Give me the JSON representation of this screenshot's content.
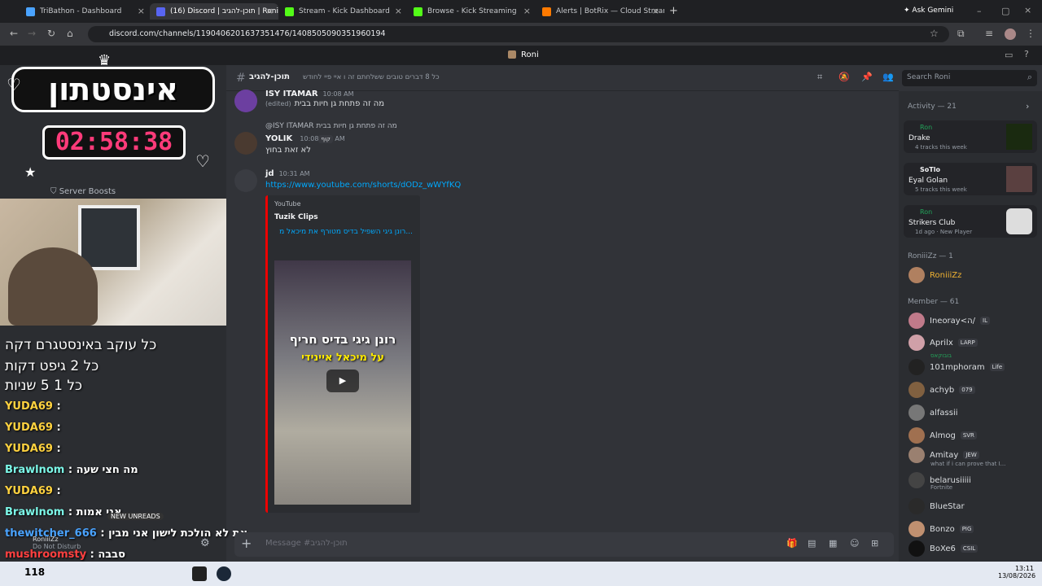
{
  "tabs": [
    {
      "label": "TriBathon - Dashboard",
      "color": "#4aa3ff"
    },
    {
      "label": "(16) Discord | תוכן-להגיב | Roni",
      "color": "#5865f2"
    },
    {
      "label": "Stream - Kick Dashboard",
      "color": "#53fc18"
    },
    {
      "label": "Browse - Kick Streaming",
      "color": "#53fc18"
    },
    {
      "label": "Alerts | BotRix — Cloud Stream",
      "color": "#ff7a00"
    }
  ],
  "gemini_label": "Ask Gemini",
  "url": "discord.com/channels/1190406201637351476/1408505090351960194",
  "server_name": "Roni",
  "overlay": {
    "logo_text": "אינסטתון",
    "timer": "02:58:38",
    "server_boosts": "Server Boosts"
  },
  "channel": {
    "name": "תוכן-להגיב",
    "topic": "כל 8 דברים טובים ששלחתם זה ו איי פיי לחודש",
    "search_placeholder": "Search Roni"
  },
  "messages": [
    {
      "user": "ISY ITAMAR",
      "time": "10:08 AM",
      "text": "מה זה פתחת גן חיות בבית",
      "edited": "(edited)"
    },
    {
      "reply": "@ISY ITAMAR",
      "reply_text": "מה זה פתחת גן חיות בבית",
      "user": "YOLIK",
      "tag": "קוף",
      "time": "10:08 AM",
      "text": "לא זאת בחוץ"
    },
    {
      "user": "jd",
      "time": "10:31 AM",
      "text": "https://www.youtube.com/shorts/dODz_wWYfKQ"
    }
  ],
  "embed": {
    "provider": "YouTube",
    "author": "Tuzik Clips",
    "title": "רונן גיגי השפיל בדיס מטורף את מיכאל מ...",
    "caption1": "רונן גיגי בדיס חריף",
    "caption2": "על מיכאל איינידי"
  },
  "composer_placeholder": "Message #תוכן-להגיב",
  "members": {
    "activity_header": "Activity — 21",
    "activities": [
      {
        "user": "Ron",
        "title": "Drake",
        "sub": "4 tracks this week"
      },
      {
        "user": "SoTlo",
        "title": "Eyal Golan",
        "sub": "5 tracks this week"
      },
      {
        "user": "Ron",
        "title": "Strikers Club",
        "sub": "1d ago",
        "sub2": "New Player"
      }
    ],
    "role_header": "RoniiiZz — 1",
    "role_member": "RoniiiZz",
    "member_header": "Member — 61",
    "list": [
      {
        "name": "Ineoray<ה/",
        "tag": "IL"
      },
      {
        "name": "Aprilx",
        "tag": "LARP",
        "sub": "בובוקאס"
      },
      {
        "name": "101mphoram",
        "tag": "Life"
      },
      {
        "name": "achyb",
        "tag": "079"
      },
      {
        "name": "alfassii",
        "tag": ""
      },
      {
        "name": "Almog",
        "tag": "SVR"
      },
      {
        "name": "Amitay",
        "tag": "JEW",
        "sub": "what if i can prove that I..."
      },
      {
        "name": "belarusiiiii",
        "tag": "",
        "sub": "Fortnite"
      },
      {
        "name": "BlueStar",
        "tag": ""
      },
      {
        "name": "Bonzo",
        "tag": "PIG"
      },
      {
        "name": "BoXe6",
        "tag": "CSIL"
      }
    ]
  },
  "overlay_chat": [
    {
      "user": "YUDA69",
      "text": ":",
      "color": "#ffd23f"
    },
    {
      "user": "YUDA69",
      "text": ":",
      "color": "#ffd23f"
    },
    {
      "user": "YUDA69",
      "text": ":",
      "color": "#ffd23f"
    },
    {
      "user": "Brawlnom",
      "text": ": מה חצי שעה",
      "color": "#7cf8e8"
    },
    {
      "user": "YUDA69",
      "text": ":",
      "color": "#ffd23f"
    },
    {
      "user": "Brawlnom",
      "text": ": אני אמות",
      "color": "#7cf8e8"
    },
    {
      "user": "thewitcher_666",
      "text": ": את לא הולכת לישון אני מבין",
      "color": "#4aa3ff"
    },
    {
      "user": "mushroomsty",
      "text": ": סבבה",
      "color": "#ff4040"
    }
  ],
  "overlay_alert": {
    "line1": "כל עוקב באינסטגרם דקה",
    "line2": "כל 2 גיפט דקות",
    "line3": "כל 1 5 שניות"
  },
  "left_user": {
    "name": "RoniiiZz",
    "status": "Do Not Disturb",
    "new_unreads": "NEW UNREADS"
  },
  "taskbar": {
    "time": "13:11",
    "date": "13/08/2026",
    "count": "118"
  }
}
